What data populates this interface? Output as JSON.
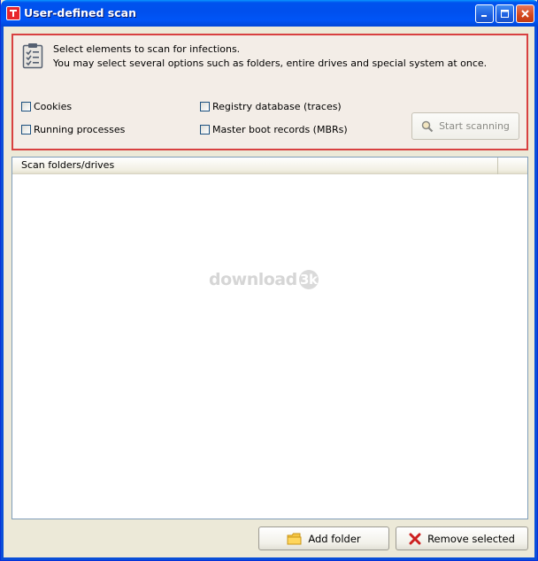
{
  "window": {
    "title": "User-defined scan"
  },
  "options": {
    "description_line1": "Select elements to scan for infections.",
    "description_line2": "You may select several options such as folders, entire drives and special system at once.",
    "checkboxes": [
      {
        "label": "Cookies",
        "checked": false
      },
      {
        "label": "Running processes",
        "checked": false
      },
      {
        "label": "Registry database (traces)",
        "checked": false
      },
      {
        "label": "Master boot records (MBRs)",
        "checked": false
      }
    ],
    "start_button": {
      "label": "Start scanning",
      "enabled": false,
      "icon": "magnifier-icon"
    }
  },
  "list": {
    "column_header": "Scan folders/drives",
    "rows": [],
    "watermark_text": "download",
    "watermark_badge": "3k"
  },
  "footer": {
    "add_folder_label": "Add folder",
    "add_folder_icon": "folder-icon",
    "remove_selected_label": "Remove selected",
    "remove_selected_icon": "red-x-icon"
  },
  "colors": {
    "titlebar": "#0053ee",
    "panel_border": "#d84040",
    "panel_background": "#f3ede7",
    "window_background": "#ece9d8"
  }
}
